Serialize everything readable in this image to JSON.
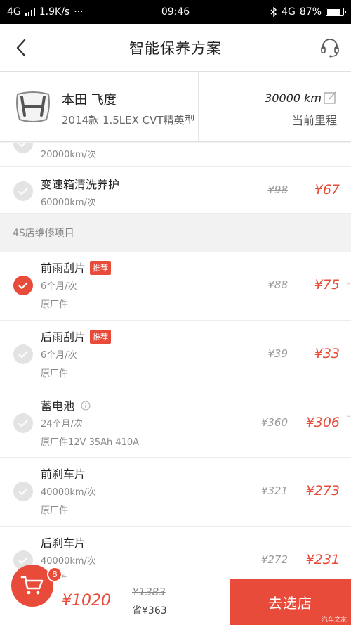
{
  "status_bar": {
    "network": "4G",
    "speed": "1.9K/s",
    "dots": "···",
    "time": "09:46",
    "bluetooth_icon": "bluetooth-icon",
    "network_right": "4G",
    "battery": "87%",
    "battery_level": 0.87
  },
  "header": {
    "title": "智能保养方案",
    "back_icon": "chevron-left-icon",
    "support_icon": "headset-icon"
  },
  "car": {
    "name": "本田 飞度",
    "model": "2014款 1.5LEX CVT精英型",
    "mileage": "30000 km",
    "mileage_label": "当前里程"
  },
  "items_partial": {
    "sub": "20000km/次"
  },
  "items_top": [
    {
      "name": "变速箱清洗养护",
      "sub": "60000km/次",
      "orig": "¥98",
      "price": "¥67",
      "checked": false
    }
  ],
  "section": {
    "title": "4S店维修项目"
  },
  "items": [
    {
      "name": "前雨刮片",
      "tag": "推荐",
      "sub": "6个月/次",
      "sub2": "原厂件",
      "orig": "¥88",
      "price": "¥75",
      "checked": true
    },
    {
      "name": "后雨刮片",
      "tag": "推荐",
      "sub": "6个月/次",
      "sub2": "原厂件",
      "orig": "¥39",
      "price": "¥33",
      "checked": false
    },
    {
      "name": "蓄电池",
      "sub": "24个月/次",
      "sub2": "原厂件12V 35Ah 410A",
      "orig": "¥360",
      "price": "¥306",
      "checked": false
    },
    {
      "name": "前刹车片",
      "sub": "40000km/次",
      "sub2": "原厂件",
      "orig": "¥321",
      "price": "¥273",
      "checked": false
    },
    {
      "name": "后刹车片",
      "sub": "40000km/次",
      "sub2": "原厂件",
      "orig": "¥272",
      "price": "¥231",
      "checked": false
    }
  ],
  "bottom": {
    "cart_count": "8",
    "total": "¥1020",
    "total_orig": "¥1383",
    "saved": "省¥363",
    "checkout": "去选店",
    "watermark": "汽车之家"
  },
  "colors": {
    "accent": "#e84b3a",
    "unchecked": "#e3e3e3"
  }
}
